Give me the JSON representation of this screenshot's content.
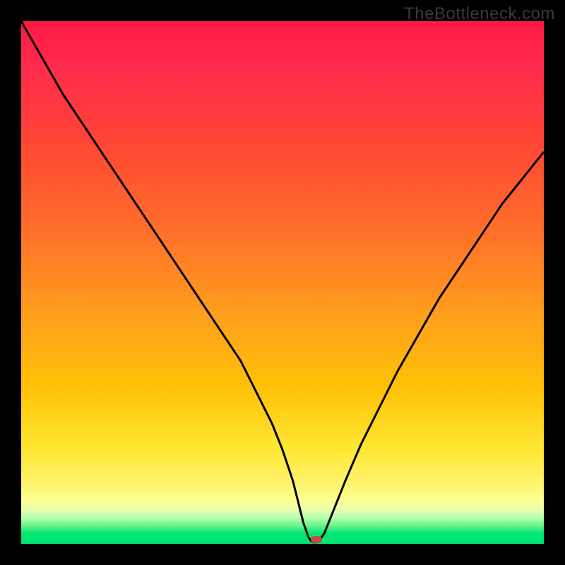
{
  "watermark": "TheBottleneck.com",
  "chart_data": {
    "type": "line",
    "title": "",
    "xlabel": "",
    "ylabel": "",
    "xlim": [
      0,
      100
    ],
    "ylim": [
      0,
      100
    ],
    "grid": false,
    "series": [
      {
        "name": "curve",
        "x": [
          0,
          4,
          8,
          12,
          16,
          20,
          24,
          28,
          32,
          36,
          40,
          42,
          44,
          46,
          48,
          50,
          52,
          53,
          54,
          55,
          55.5,
          56,
          56.5,
          57,
          58,
          60,
          62,
          65,
          68,
          72,
          76,
          80,
          84,
          88,
          92,
          96,
          100
        ],
        "y": [
          100,
          93,
          86,
          80,
          74,
          68,
          62,
          56,
          50,
          44,
          38,
          35,
          31,
          27,
          23,
          18,
          12,
          8,
          4,
          1.2,
          0.5,
          0.3,
          0.3,
          0.6,
          2,
          7,
          12,
          19,
          25,
          33,
          40,
          47,
          53,
          59,
          65,
          70,
          75
        ]
      }
    ],
    "marker": {
      "x": 56.5,
      "y": 0.8,
      "color": "#c44a45"
    },
    "background_gradient": {
      "top": "#ff1744",
      "mid": "#ffc107",
      "bottom": "#00e676"
    }
  },
  "colors": {
    "curve_stroke": "#000000",
    "marker_fill": "#c44a45",
    "frame_bg": "#000000"
  }
}
